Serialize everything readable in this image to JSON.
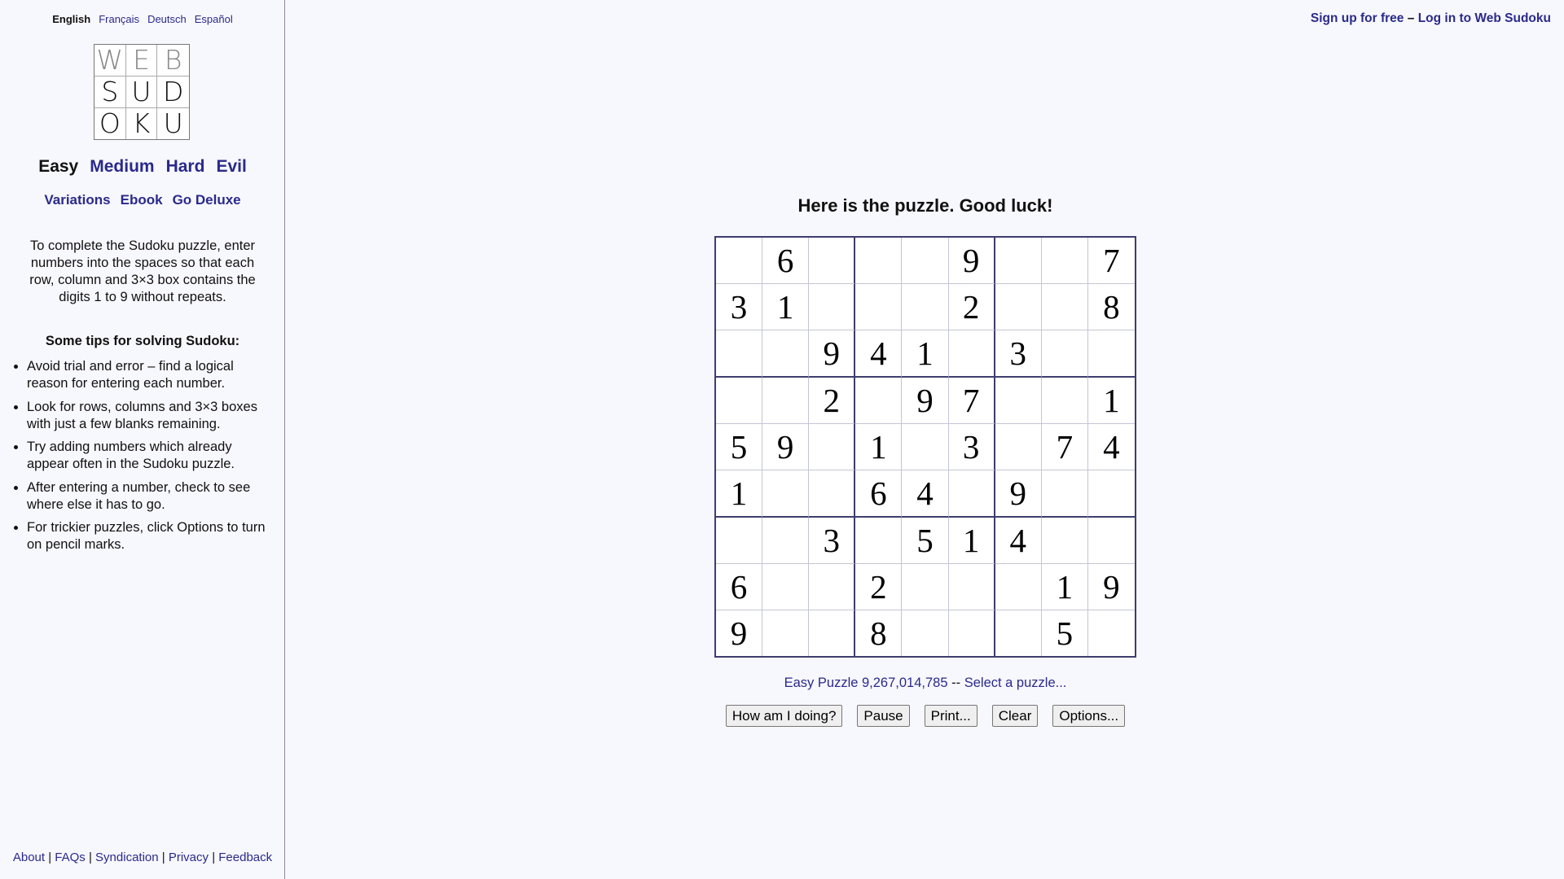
{
  "languages": [
    {
      "label": "English",
      "current": true
    },
    {
      "label": "Français",
      "current": false
    },
    {
      "label": "Deutsch",
      "current": false
    },
    {
      "label": "Español",
      "current": false
    }
  ],
  "logo_letters": [
    "W",
    "E",
    "B",
    "S",
    "U",
    "D",
    "O",
    "K",
    "U"
  ],
  "levels": [
    {
      "label": "Easy",
      "current": true
    },
    {
      "label": "Medium",
      "current": false
    },
    {
      "label": "Hard",
      "current": false
    },
    {
      "label": "Evil",
      "current": false
    }
  ],
  "extras": [
    "Variations",
    "Ebook",
    "Go Deluxe"
  ],
  "intro_text": "To complete the Sudoku puzzle, enter numbers into the spaces so that each row, column and 3×3 box contains the digits 1 to 9 without repeats.",
  "tips_title": "Some tips for solving Sudoku:",
  "tips": [
    "Avoid trial and error – find a logical reason for entering each number.",
    "Look for rows, columns and 3×3 boxes with just a few blanks remaining.",
    "Try adding numbers which already appear often in the Sudoku puzzle.",
    "After entering a number, check to see where else it has to go.",
    "For trickier puzzles, click Options to turn on pencil marks."
  ],
  "footer_links": [
    "About",
    "FAQs",
    "Syndication",
    "Privacy",
    "Feedback"
  ],
  "account": {
    "signup": "Sign up for free",
    "separator": "–",
    "login": "Log in to Web Sudoku"
  },
  "headline": "Here is the puzzle. Good luck!",
  "grid": [
    [
      "",
      "6",
      "",
      "",
      "",
      "9",
      "",
      "",
      "7"
    ],
    [
      "3",
      "1",
      "",
      "",
      "",
      "2",
      "",
      "",
      "8"
    ],
    [
      "",
      "",
      "9",
      "4",
      "1",
      "",
      "3",
      "",
      ""
    ],
    [
      "",
      "",
      "2",
      "",
      "9",
      "7",
      "",
      "",
      "1"
    ],
    [
      "5",
      "9",
      "",
      "1",
      "",
      "3",
      "",
      "7",
      "4"
    ],
    [
      "1",
      "",
      "",
      "6",
      "4",
      "",
      "9",
      "",
      ""
    ],
    [
      "",
      "",
      "3",
      "",
      "5",
      "1",
      "4",
      "",
      ""
    ],
    [
      "6",
      "",
      "",
      "2",
      "",
      "",
      "",
      "1",
      "9"
    ],
    [
      "9",
      "",
      "",
      "8",
      "",
      "",
      "",
      "5",
      ""
    ]
  ],
  "puzzle_info": {
    "label": "Easy Puzzle 9,267,014,785",
    "separator": "--",
    "select": "Select a puzzle..."
  },
  "buttons": [
    "How am I doing?",
    "Pause",
    "Print...",
    "Clear",
    "Options..."
  ]
}
